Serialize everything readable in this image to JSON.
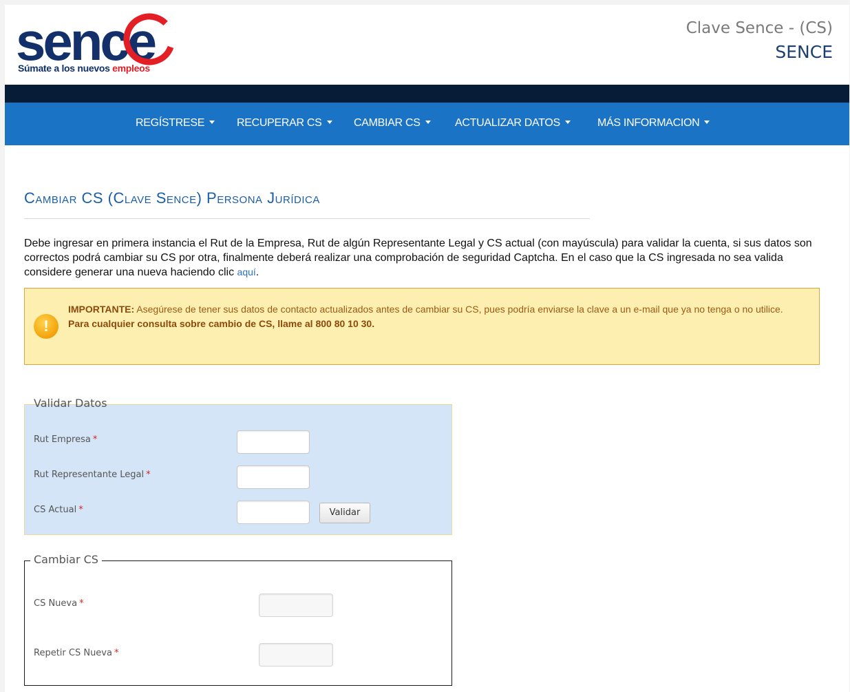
{
  "header": {
    "logo_text": "sence",
    "tagline_main": "Súmate a los nuevos",
    "tagline_accent": "empleos",
    "title": "Clave Sence - (CS)",
    "subtitle": "SENCE"
  },
  "nav": {
    "items": [
      {
        "label": "REGÍSTRESE"
      },
      {
        "label": "RECUPERAR CS"
      },
      {
        "label": "CAMBIAR CS"
      },
      {
        "label": "ACTUALIZAR DATOS"
      },
      {
        "label": "MÁS INFORMACION"
      }
    ]
  },
  "page": {
    "title": "Cambiar CS (Clave Sence) Persona Jurídica",
    "intro": "Debe ingresar en primera instancia el Rut de la Empresa, Rut de algún Representante Legal y CS actual (con mayúscula) para validar la cuenta, si sus datos son correctos podrá cambiar su CS por otra, finalmente deberá realizar una comprobación de seguridad Captcha. En el caso que la CS ingresada no sea valida considere generar una nueva haciendo clic",
    "intro_link": "aquí",
    "intro_end": "."
  },
  "alert": {
    "icon": "warning-icon",
    "strong": "IMPORTANTE:",
    "text": " Asegúrese de tener sus datos de contacto actualizados antes de cambiar su CS, pues podría enviarse la clave a un e-mail que ya no tenga o no utilice.",
    "line2": "Para cualquier consulta sobre cambio de CS, llame al 800 80 10 30."
  },
  "validar": {
    "legend": "Validar Datos",
    "rut_empresa_label": "Rut Empresa",
    "rut_rep_label": "Rut Representante Legal",
    "cs_actual_label": "CS Actual",
    "button": "Validar",
    "required_mark": "*"
  },
  "cambiar": {
    "legend": "Cambiar CS",
    "cs_nueva_label": "CS Nueva",
    "repetir_label": "Repetir CS Nueva",
    "required_mark": "*"
  },
  "colors": {
    "navbar": "#1b73c6",
    "darkbar": "#071c36",
    "title": "#1a5ea8",
    "alert_bg": "#fdefb0",
    "fieldset_bg": "#d3e5f7"
  }
}
